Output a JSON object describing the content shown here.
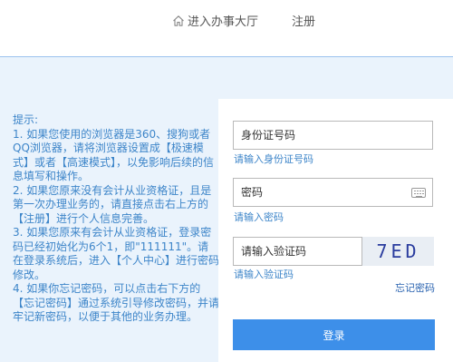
{
  "header": {
    "nav_hall": "进入办事大厅",
    "nav_hall_icon": "home-icon",
    "nav_register": "注册"
  },
  "tips": {
    "title": "提示:",
    "items": [
      "1. 如果您使用的浏览器是360、搜狗或者QQ浏览器，请将浏览器设置成【极速模式】或者【高速模式】，以免影响后续的信息填写和操作。",
      "2. 如果您原来没有会计从业资格证，且是第一次办理业务的，请直接点击右上方的【注册】进行个人信息完善。",
      "3. 如果您原来有会计从业资格证，登录密码已经初始化为6个1，即\"111111\"。请在登录系统后，进入【个人中心】进行密码修改。",
      "4. 如果你忘记密码，可以点击右下方的【忘记密码】通过系统引导修改密码，并请牢记新密码，以便于其他的业务办理。"
    ]
  },
  "login": {
    "id_placeholder": "身份证号码",
    "id_hint": "请输入身份证号码",
    "password_placeholder": "密码",
    "password_hint": "请输入密码",
    "keyboard_icon": "keyboard-icon",
    "code_placeholder": "请输入验证码",
    "code_hint": "请输入验证码",
    "captcha_text": "7ED",
    "forgot": "忘记密码",
    "submit": "登录"
  },
  "colors": {
    "accent": "#3d8fe9",
    "link": "#3d85c9",
    "background": "#eaf3fc",
    "captcha_text": "#2a3c9e"
  }
}
